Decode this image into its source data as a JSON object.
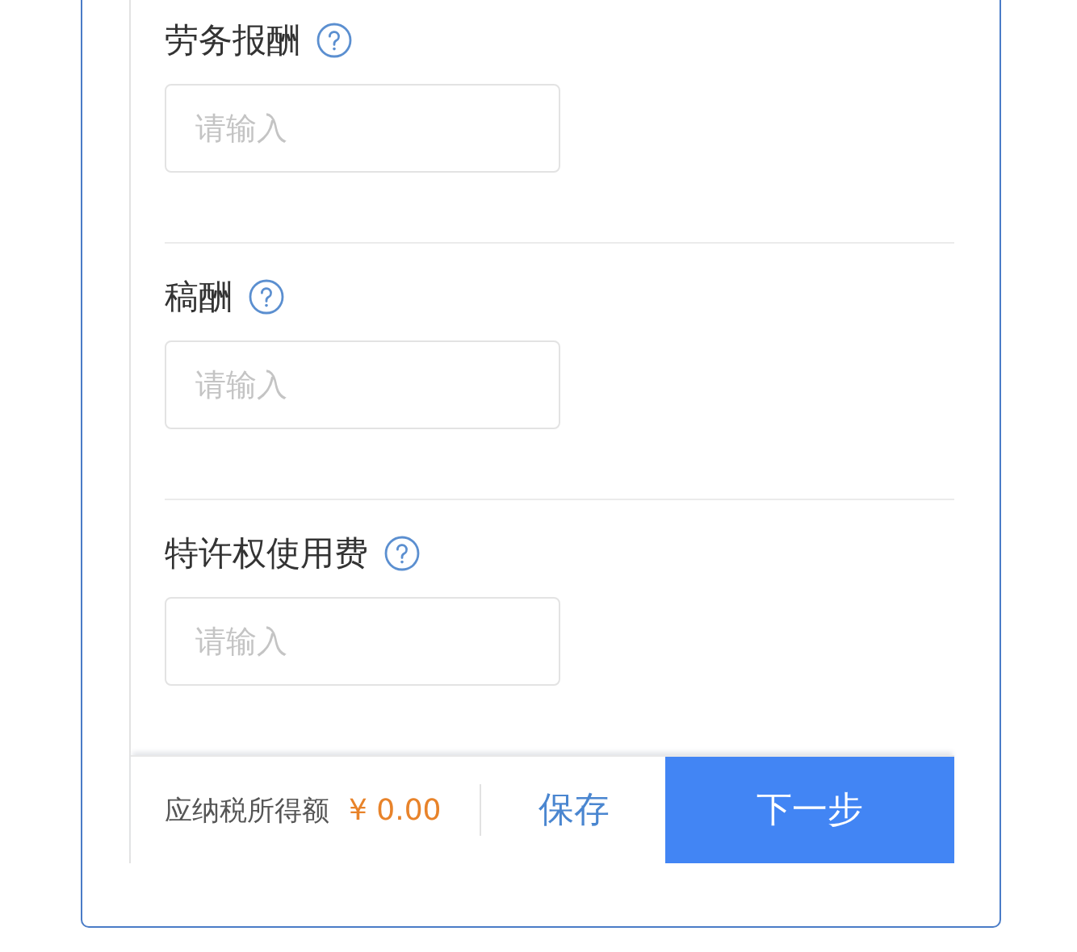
{
  "fields": [
    {
      "label": "劳务报酬",
      "placeholder": "请输入"
    },
    {
      "label": "稿酬",
      "placeholder": "请输入"
    },
    {
      "label": "特许权使用费",
      "placeholder": "请输入"
    }
  ],
  "footer": {
    "amount_label": "应纳税所得额",
    "amount": "¥ 0.00",
    "save_button": "保存",
    "next_button": "下一步"
  }
}
